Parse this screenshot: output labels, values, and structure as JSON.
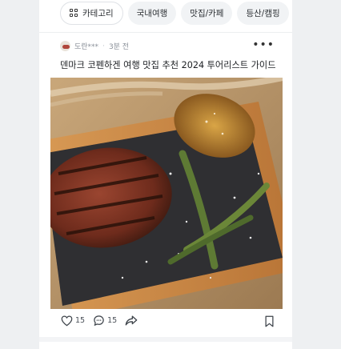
{
  "chips": [
    {
      "label": "카테고리",
      "icon": "grid-icon"
    },
    {
      "label": "국내여행"
    },
    {
      "label": "맛집/카페"
    },
    {
      "label": "등산/캠핑"
    }
  ],
  "post": {
    "author": "도란***",
    "time": "3분 전",
    "title": "덴마크 코펜하겐 여행 맛집 추천 2024 투어리스트 가이드",
    "likes": "15",
    "comments": "15"
  }
}
